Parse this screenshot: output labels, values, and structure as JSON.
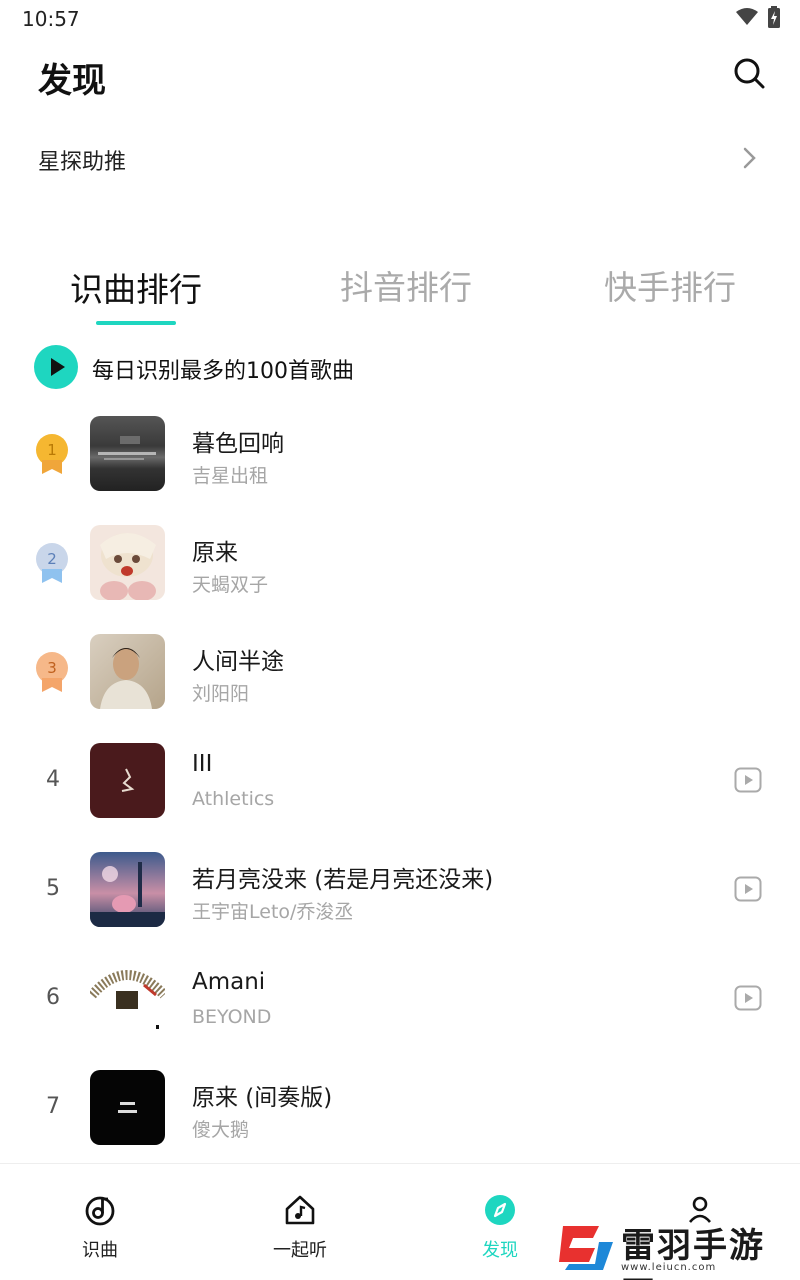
{
  "status_bar": {
    "time": "10:57"
  },
  "header": {
    "title": "发现",
    "search_icon": "search-icon"
  },
  "promo": {
    "label": "星探助推"
  },
  "tabs": [
    {
      "label": "识曲排行",
      "active": true
    },
    {
      "label": "抖音排行",
      "active": false
    },
    {
      "label": "快手排行",
      "active": false
    }
  ],
  "daily": {
    "label": "每日识别最多的100首歌曲"
  },
  "songs": [
    {
      "rank": "1",
      "title": "暮色回响",
      "artist": "吉星出租",
      "medal": "gold",
      "video": false
    },
    {
      "rank": "2",
      "title": "原来",
      "artist": "天蝎双子",
      "medal": "silver",
      "video": false
    },
    {
      "rank": "3",
      "title": "人间半途",
      "artist": "刘阳阳",
      "medal": "bronze",
      "video": false
    },
    {
      "rank": "4",
      "title": "III",
      "artist": "Athletics",
      "medal": "",
      "video": true
    },
    {
      "rank": "5",
      "title": "若月亮没来 (若是月亮还没来)",
      "artist": "王宇宙Leto/乔浚丞",
      "medal": "",
      "video": true
    },
    {
      "rank": "6",
      "title": "Amani",
      "artist": "BEYOND",
      "medal": "",
      "video": true
    },
    {
      "rank": "7",
      "title": "原来 (间奏版)",
      "artist": "傻大鹅",
      "medal": "",
      "video": false
    }
  ],
  "bottom_nav": [
    {
      "label": "识曲",
      "icon": "music-note-icon",
      "active": false
    },
    {
      "label": "一起听",
      "icon": "house-music-icon",
      "active": false
    },
    {
      "label": "发现",
      "icon": "compass-icon",
      "active": true
    }
  ],
  "watermark": {
    "text": "雷羽手游网",
    "url": "www.leiucn.com"
  },
  "colors": {
    "accent": "#1ed6c0",
    "gold": "#f5b731",
    "silver": "#9bb6dd",
    "bronze": "#f0a070"
  }
}
